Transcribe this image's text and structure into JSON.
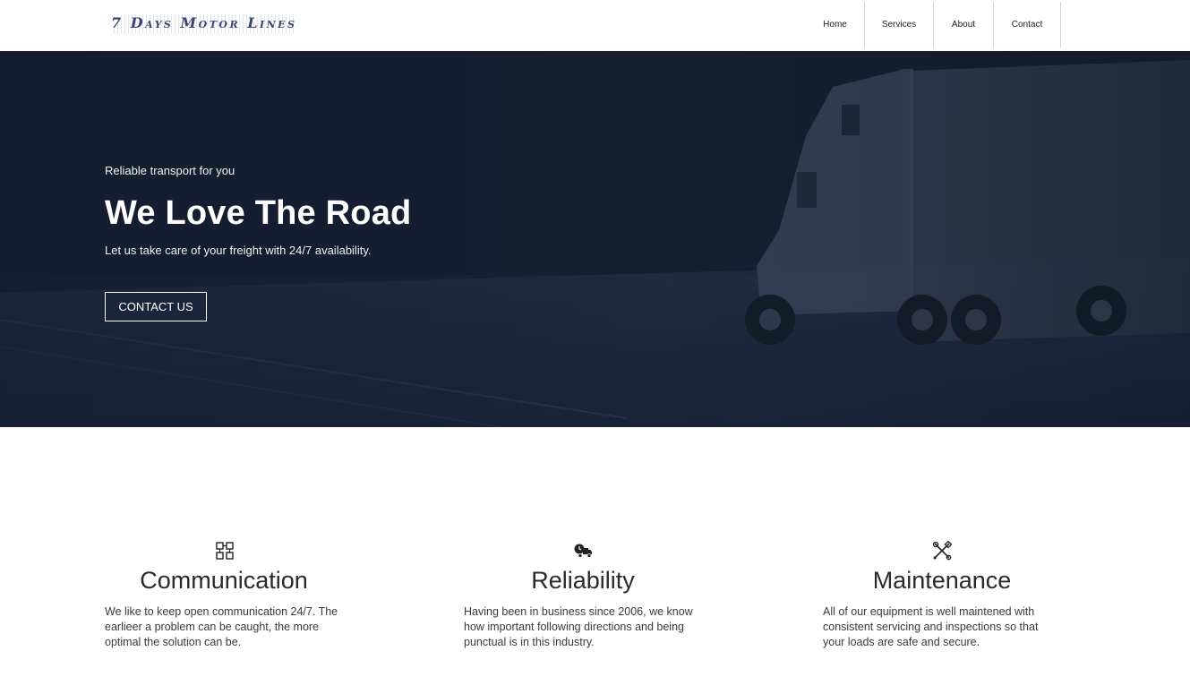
{
  "header": {
    "logo_text": "7 Days Motor Lines",
    "nav": [
      {
        "label": "Home"
      },
      {
        "label": "Services"
      },
      {
        "label": "About"
      },
      {
        "label": "Contact"
      }
    ]
  },
  "hero": {
    "tagline": "Reliable transport for you",
    "title": "We Love The Road",
    "subtitle": "Let us take care of your freight with 24/7 availability.",
    "button_label": "CONTACT US"
  },
  "features": [
    {
      "icon": "network-boxes-icon",
      "title": "Communication",
      "text": "We like to keep open communication 24/7. The earlieer a problem can be caught, the more optimal the solution can be."
    },
    {
      "icon": "delivery-truck-clock-icon",
      "title": "Reliability",
      "text": "Having been in business since 2006, we know how important following directions and being punctual is in this industry."
    },
    {
      "icon": "wrench-screwdriver-icon",
      "title": "Maintenance",
      "text": "All of our equipment is well maintened with consistent servicing and inspections so that your loads are safe and secure."
    }
  ],
  "colors": {
    "logo": "#3c4475",
    "hero_bg": "#1a2438",
    "text_dark": "#222222"
  }
}
